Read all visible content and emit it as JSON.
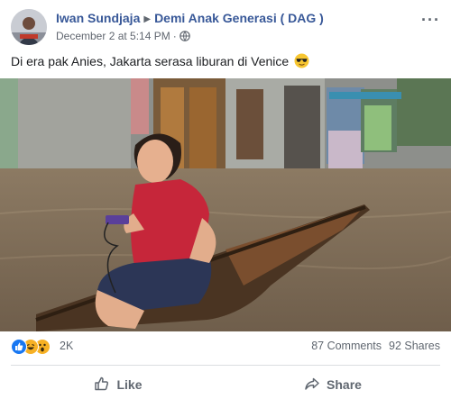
{
  "post": {
    "author": "Iwan Sundjaja",
    "group": "Demi Anak Generasi ( DAG )",
    "timestamp": "December 2 at 5:14 PM",
    "message": "Di era pak Anies, Jakarta serasa liburan di Venice"
  },
  "icons": {
    "separator": "triangle-right-icon",
    "privacy": "globe-icon",
    "emoji": "sunglasses-emoji-icon",
    "reactions": [
      "like-reaction-icon",
      "haha-reaction-icon",
      "wow-reaction-icon"
    ],
    "like": "thumbs-up-icon",
    "share": "share-arrow-icon"
  },
  "stats": {
    "reactions": "2K",
    "comments": "87 Comments",
    "shares": "92 Shares"
  },
  "actions": {
    "like": "Like",
    "share": "Share"
  },
  "colors": {
    "link": "#385898",
    "like_blue": "#1877f2",
    "reaction_yellow": "#f7b125",
    "muted": "#606770"
  }
}
